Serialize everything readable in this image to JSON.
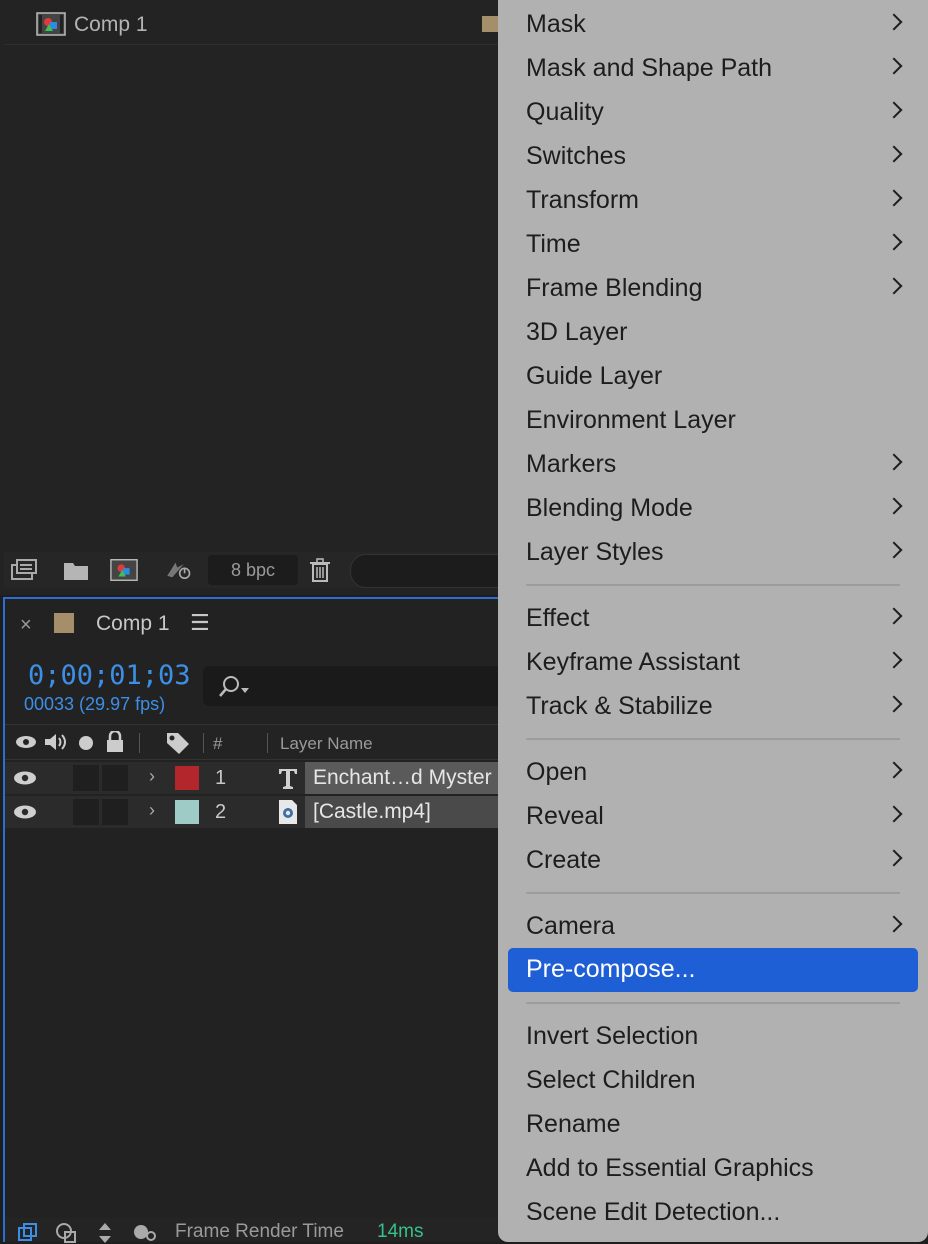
{
  "project": {
    "item_name": "Comp 1",
    "bpc": "8 bpc"
  },
  "timeline": {
    "tab_title": "Comp 1",
    "close_glyph": "×",
    "menu_glyph": "☰",
    "timecode": "0;00;01;03",
    "frames": "00033 (29.97 fps)",
    "header": {
      "hash": "#",
      "layer_name": "Layer Name"
    },
    "layers": [
      {
        "number": "1",
        "name": "Enchant…d Myster",
        "label_color": "#b2262c",
        "type_icon": "text-layer-icon"
      },
      {
        "number": "2",
        "name": "[Castle.mp4]",
        "label_color": "#9fcbc6",
        "type_icon": "video-file-icon"
      }
    ],
    "status": {
      "label": "Frame Render Time",
      "value": "14ms"
    }
  },
  "context_menu": {
    "items": [
      {
        "label": "Mask",
        "submenu": true
      },
      {
        "label": "Mask and Shape Path",
        "submenu": true
      },
      {
        "label": "Quality",
        "submenu": true
      },
      {
        "label": "Switches",
        "submenu": true
      },
      {
        "label": "Transform",
        "submenu": true
      },
      {
        "label": "Time",
        "submenu": true
      },
      {
        "label": "Frame Blending",
        "submenu": true
      },
      {
        "label": "3D Layer",
        "submenu": false
      },
      {
        "label": "Guide Layer",
        "submenu": false
      },
      {
        "label": "Environment Layer",
        "submenu": false
      },
      {
        "label": "Markers",
        "submenu": true
      },
      {
        "label": "Blending Mode",
        "submenu": true
      },
      {
        "label": "Layer Styles",
        "submenu": true
      },
      {
        "label": "Effect",
        "submenu": true
      },
      {
        "label": "Keyframe Assistant",
        "submenu": true
      },
      {
        "label": "Track & Stabilize",
        "submenu": true
      },
      {
        "label": "Open",
        "submenu": true
      },
      {
        "label": "Reveal",
        "submenu": true
      },
      {
        "label": "Create",
        "submenu": true
      },
      {
        "label": "Camera",
        "submenu": true
      },
      {
        "label": "Pre-compose...",
        "submenu": false,
        "highlighted": true
      },
      {
        "label": "Invert Selection",
        "submenu": false
      },
      {
        "label": "Select Children",
        "submenu": false
      },
      {
        "label": "Rename",
        "submenu": false
      },
      {
        "label": "Add to Essential Graphics",
        "submenu": false
      },
      {
        "label": "Scene Edit Detection...",
        "submenu": false
      }
    ],
    "highlight_color": "#1f5fd6"
  }
}
